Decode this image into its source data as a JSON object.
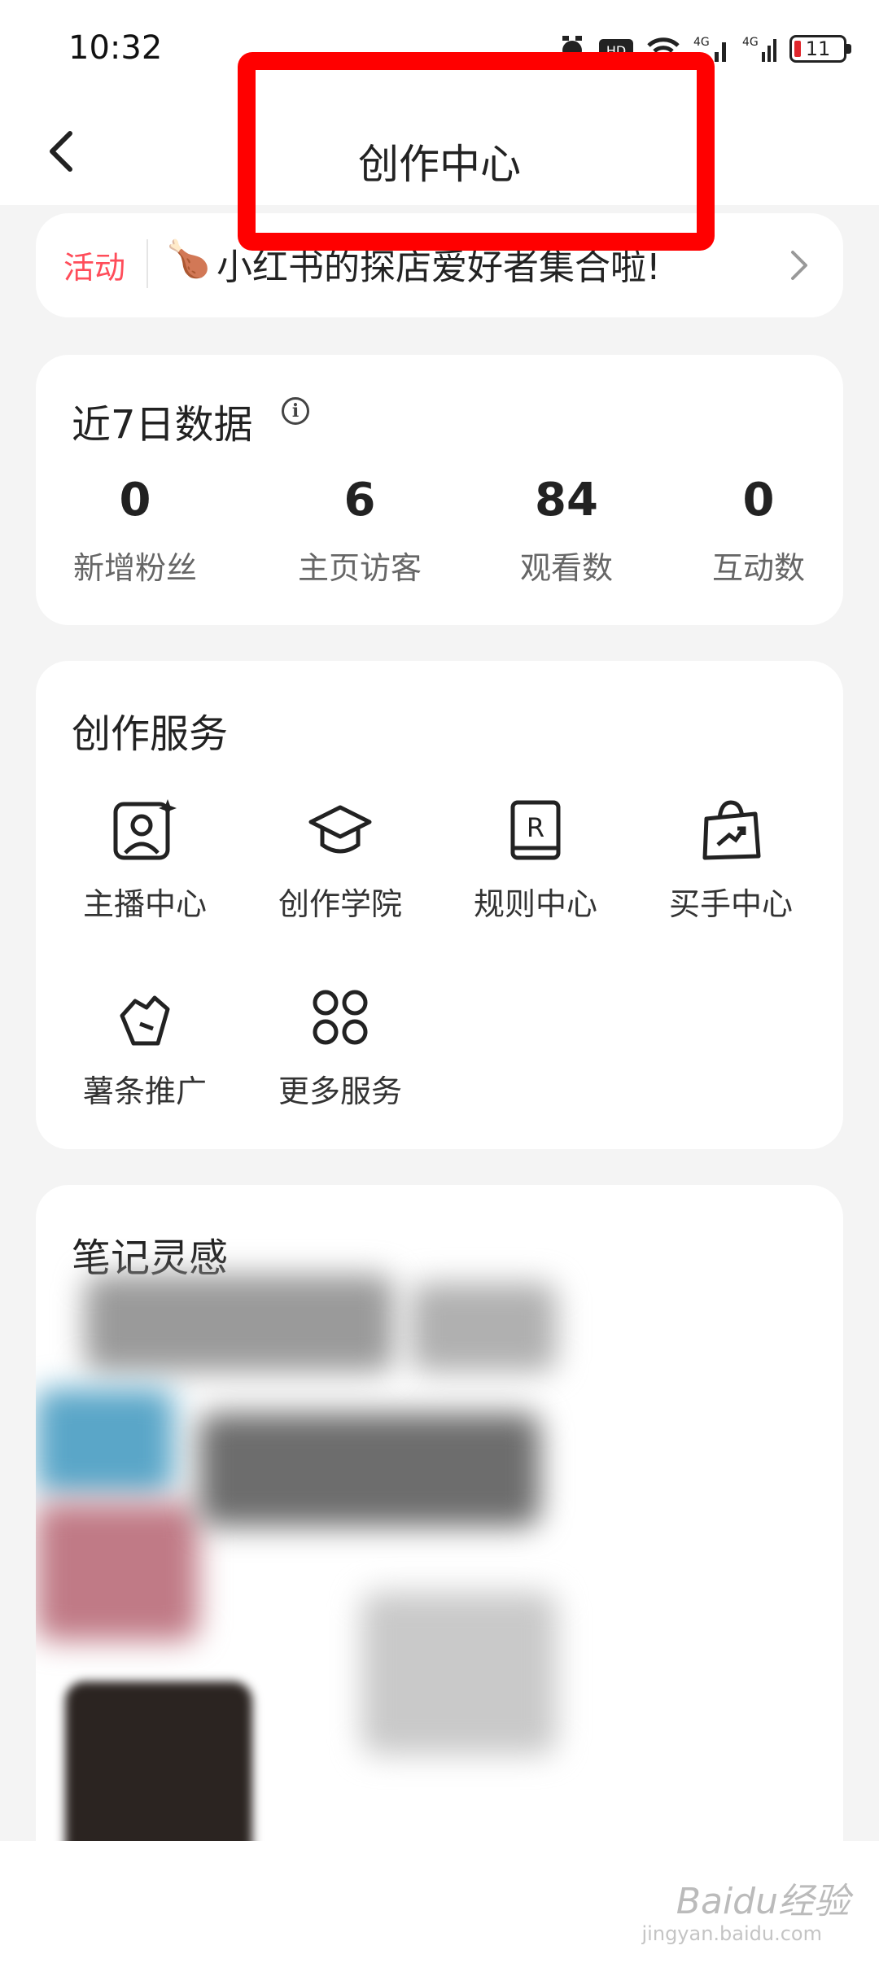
{
  "status_bar": {
    "time": "10:32",
    "battery": "11"
  },
  "header": {
    "title": "创作中心"
  },
  "activity": {
    "tag": "活动",
    "emoji": "🍗",
    "text": "小红书的探店爱好者集合啦!"
  },
  "stats": {
    "title": "近7日数据",
    "items": [
      {
        "value": "0",
        "label": "新增粉丝"
      },
      {
        "value": "6",
        "label": "主页访客"
      },
      {
        "value": "84",
        "label": "观看数"
      },
      {
        "value": "0",
        "label": "互动数"
      }
    ]
  },
  "services": {
    "title": "创作服务",
    "items": [
      {
        "label": "主播中心",
        "icon": "streamer-icon"
      },
      {
        "label": "创作学院",
        "icon": "graduation-cap-icon"
      },
      {
        "label": "规则中心",
        "icon": "rules-book-icon"
      },
      {
        "label": "买手中心",
        "icon": "shopping-bag-icon"
      },
      {
        "label": "薯条推广",
        "icon": "fries-promo-icon"
      },
      {
        "label": "更多服务",
        "icon": "more-grid-icon"
      }
    ]
  },
  "notes": {
    "title": "笔记灵感"
  },
  "watermark": {
    "brand": "Baidu经验",
    "url": "jingyan.baidu.com"
  },
  "colors": {
    "accent": "#ff4d5a",
    "highlight_box": "#ff0000"
  }
}
